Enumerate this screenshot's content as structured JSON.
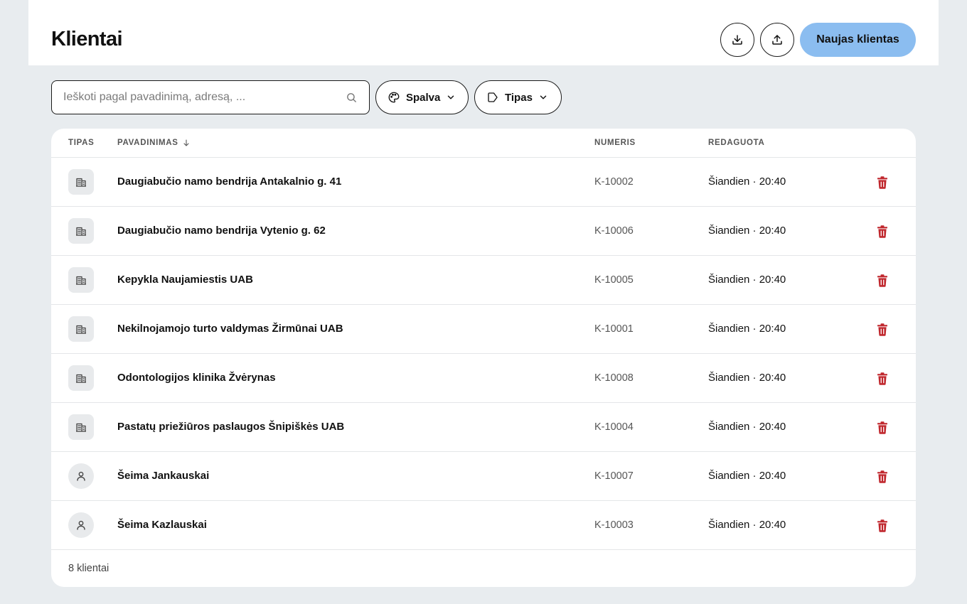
{
  "header": {
    "title": "Klientai",
    "download_icon": "download-icon",
    "upload_icon": "upload-icon",
    "new_button_label": "Naujas klientas"
  },
  "filters": {
    "search_placeholder": "Ieškoti pagal pavadinimą, adresą, ...",
    "search_value": "",
    "color_filter_label": "Spalva",
    "type_filter_label": "Tipas"
  },
  "table": {
    "columns": {
      "type": "TIPAS",
      "name": "PAVADINIMAS",
      "number": "NUMERIS",
      "edited": "REDAGUOTA"
    },
    "sort": {
      "column": "name",
      "direction": "descending-arrow"
    },
    "rows": [
      {
        "type": "company",
        "name": "Daugiabučio namo bendrija Antakalnio g. 41",
        "number": "K-10002",
        "edited": "Šiandien · 20:40"
      },
      {
        "type": "company",
        "name": "Daugiabučio namo bendrija Vytenio g. 62",
        "number": "K-10006",
        "edited": "Šiandien · 20:40"
      },
      {
        "type": "company",
        "name": "Kepykla Naujamiestis UAB",
        "number": "K-10005",
        "edited": "Šiandien · 20:40"
      },
      {
        "type": "company",
        "name": "Nekilnojamojo turto valdymas Žirmūnai UAB",
        "number": "K-10001",
        "edited": "Šiandien · 20:40"
      },
      {
        "type": "company",
        "name": "Odontologijos klinika Žvėrynas",
        "number": "K-10008",
        "edited": "Šiandien · 20:40"
      },
      {
        "type": "company",
        "name": "Pastatų priežiūros paslaugos Šnipiškės UAB",
        "number": "K-10004",
        "edited": "Šiandien · 20:40"
      },
      {
        "type": "person",
        "name": "Šeima Jankauskai",
        "number": "K-10007",
        "edited": "Šiandien · 20:40"
      },
      {
        "type": "person",
        "name": "Šeima Kazlauskai",
        "number": "K-10003",
        "edited": "Šiandien · 20:40"
      }
    ],
    "footer_count": "8 klientai"
  },
  "colors": {
    "background": "#e8ecef",
    "primary_button": "#8bbdf0",
    "delete_icon": "#c0272d",
    "type_badge_bg": "#e8eaec"
  }
}
